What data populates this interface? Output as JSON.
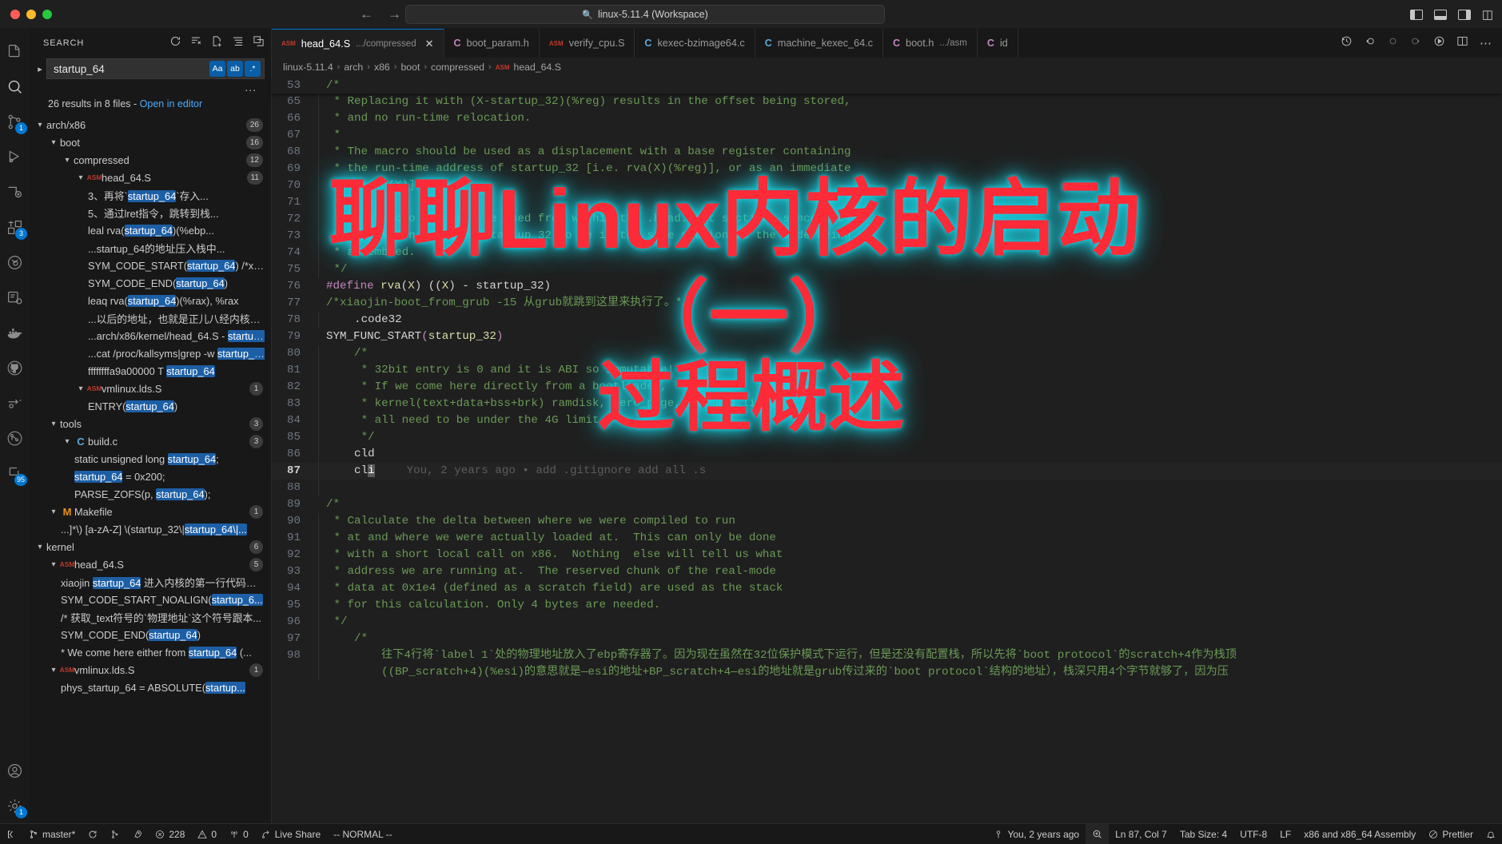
{
  "titlebar": {
    "quick_open": "linux-5.11.4 (Workspace)",
    "back_icon": "arrow-left-icon",
    "forward_icon": "arrow-right-icon",
    "search_icon": "search-icon",
    "layout_left": "toggle-primary-sidebar-icon",
    "layout_bottom": "toggle-panel-icon",
    "layout_right": "toggle-secondary-sidebar-icon",
    "customize_layout": "customize-layout-icon"
  },
  "activitybar": {
    "items": [
      {
        "name": "explorer",
        "badge": ""
      },
      {
        "name": "search",
        "badge": ""
      },
      {
        "name": "source-control",
        "badge": "1"
      },
      {
        "name": "run-and-debug",
        "badge": ""
      },
      {
        "name": "remote-explorer",
        "badge": ""
      },
      {
        "name": "extensions",
        "badge": "3"
      },
      {
        "name": "test-explorer",
        "badge": ""
      },
      {
        "name": "cpp-tools",
        "badge": ""
      },
      {
        "name": "docker",
        "badge": ""
      },
      {
        "name": "github",
        "badge": ""
      },
      {
        "name": "call-graph",
        "badge": ""
      },
      {
        "name": "git-graph",
        "badge": ""
      },
      {
        "name": "todo-tree",
        "badge": "95"
      },
      {
        "name": "accounts",
        "badge": ""
      },
      {
        "name": "settings",
        "badge": "1"
      }
    ]
  },
  "sidebar": {
    "title": "SEARCH",
    "actions": [
      "refresh-icon",
      "clear-search-results-icon",
      "open-new-search-editor-icon",
      "view-as-tree-icon",
      "collapse-all-icon"
    ],
    "search": {
      "value": "startup_64",
      "placeholder": "Search",
      "toggle_expand_icon": "chevron-right-icon",
      "options": [
        {
          "name": "match-case-toggle",
          "label": "Aa",
          "active": true
        },
        {
          "name": "match-whole-word-toggle",
          "label": "ab",
          "active": true
        },
        {
          "name": "use-regex-toggle",
          "label": ".*",
          "active": true
        }
      ],
      "more_icon": "..."
    },
    "summary": {
      "text": "26 results in 8 files - ",
      "link": "Open in editor"
    },
    "tree": [
      {
        "type": "folder",
        "indent": 0,
        "label": "arch/x86",
        "count": "26"
      },
      {
        "type": "folder",
        "indent": 1,
        "label": "boot",
        "count": "16"
      },
      {
        "type": "folder",
        "indent": 2,
        "label": "compressed",
        "count": "12"
      },
      {
        "type": "file",
        "indent": 3,
        "icon": "asm",
        "label": "head_64.S",
        "count": "11"
      },
      {
        "type": "match",
        "indent": 4,
        "pre": "3、再将`",
        "hit": "startup_64",
        "post": "`存入..."
      },
      {
        "type": "match",
        "indent": 4,
        "pre": "5、通过lret指令，跳转到栈...",
        "hit": "",
        "post": ""
      },
      {
        "type": "match",
        "indent": 4,
        "pre": "leal  rva(",
        "hit": "startup_64",
        "post": ")(%ebp..."
      },
      {
        "type": "match",
        "indent": 4,
        "pre": "...startup_64的地址压入栈中...",
        "hit": "",
        "post": ""
      },
      {
        "type": "match",
        "indent": 4,
        "pre": "SYM_CODE_START(",
        "hit": "startup_64",
        "post": ") /*xiaoj..."
      },
      {
        "type": "match",
        "indent": 4,
        "pre": "SYM_CODE_END(",
        "hit": "startup_64",
        "post": ")"
      },
      {
        "type": "match",
        "indent": 4,
        "pre": "leaq rva(",
        "hit": "startup_64",
        "post": ")(%rax), %rax"
      },
      {
        "type": "match",
        "indent": 4,
        "pre": "...以后的地址，也就是正儿八经内核代码段...",
        "hit": "",
        "post": ""
      },
      {
        "type": "match",
        "indent": 4,
        "pre": "...arch/x86/kernel/head_64.S - ",
        "hit": "startup_...",
        "post": ""
      },
      {
        "type": "match",
        "indent": 4,
        "pre": "...cat /proc/kallsyms|grep -w ",
        "hit": "startup_64",
        "post": ""
      },
      {
        "type": "match",
        "indent": 4,
        "pre": "ffffffffa9a00000 T ",
        "hit": "startup_64",
        "post": ""
      },
      {
        "type": "file",
        "indent": 3,
        "icon": "asm",
        "label": "vmlinux.lds.S",
        "count": "1"
      },
      {
        "type": "match",
        "indent": 4,
        "pre": "ENTRY(",
        "hit": "startup_64",
        "post": ")"
      },
      {
        "type": "folder",
        "indent": 1,
        "label": "tools",
        "count": "3"
      },
      {
        "type": "file",
        "indent": 2,
        "icon": "c",
        "label": "build.c",
        "count": "3"
      },
      {
        "type": "match",
        "indent": 3,
        "pre": "static unsigned long ",
        "hit": "startup_64",
        "post": ";"
      },
      {
        "type": "match",
        "indent": 3,
        "pre": "",
        "hit": "startup_64",
        "post": " = 0x200;"
      },
      {
        "type": "match",
        "indent": 3,
        "pre": "PARSE_ZOFS(p, ",
        "hit": "startup_64",
        "post": ");"
      },
      {
        "type": "file",
        "indent": 1,
        "icon": "mk",
        "label": "Makefile",
        "count": "1"
      },
      {
        "type": "match",
        "indent": 2,
        "pre": "...]*\\) [a-zA-Z] \\(startup_32\\|",
        "hit": "startup_64\\|...",
        "post": ""
      },
      {
        "type": "folder",
        "indent": 0,
        "label": "kernel",
        "count": "6"
      },
      {
        "type": "file",
        "indent": 1,
        "icon": "asm",
        "label": "head_64.S",
        "count": "5"
      },
      {
        "type": "match",
        "indent": 2,
        "pre": "xiaojin ",
        "hit": "startup_64",
        "post": " 进入内核的第一行代码运..."
      },
      {
        "type": "match",
        "indent": 2,
        "pre": "SYM_CODE_START_NOALIGN(",
        "hit": "startup_6...",
        "post": ""
      },
      {
        "type": "match",
        "indent": 2,
        "pre": "/* 获取_text符号的`物理地址`这个符号跟本...",
        "hit": "",
        "post": ""
      },
      {
        "type": "match",
        "indent": 2,
        "pre": "SYM_CODE_END(",
        "hit": "startup_64",
        "post": ")"
      },
      {
        "type": "match",
        "indent": 2,
        "pre": "* We come here either from ",
        "hit": "startup_64",
        "post": " (..."
      },
      {
        "type": "file",
        "indent": 1,
        "icon": "asm",
        "label": "vmlinux.lds.S",
        "count": "1"
      },
      {
        "type": "match",
        "indent": 2,
        "pre": "phys_startup_64 = ABSOLUTE(",
        "hit": "startup...",
        "post": ""
      }
    ]
  },
  "tabs": [
    {
      "name": "head_64.S",
      "icon": "asm",
      "sub": ".../compressed",
      "active": true,
      "closable": true
    },
    {
      "name": "boot_param.h",
      "icon": "c-purple",
      "sub": "",
      "active": false
    },
    {
      "name": "verify_cpu.S",
      "icon": "asm",
      "sub": "",
      "active": false
    },
    {
      "name": "kexec-bzimage64.c",
      "icon": "c-blue",
      "sub": "",
      "active": false
    },
    {
      "name": "machine_kexec_64.c",
      "icon": "c-blue",
      "sub": "",
      "active": false
    },
    {
      "name": "boot.h",
      "icon": "c-purple",
      "sub": ".../asm",
      "active": false
    },
    {
      "name": "id",
      "icon": "c-purple",
      "sub": "",
      "active": false
    }
  ],
  "tabbar_right_icons": [
    "history-icon",
    "go-back-icon",
    "go-to-icon",
    "go-forward-icon",
    "run-icon",
    "split-editor-icon",
    "more-actions-icon"
  ],
  "breadcrumb": [
    "linux-5.11.4",
    "arch",
    "x86",
    "boot",
    "compressed",
    "head_64.S"
  ],
  "editor": {
    "sticky_line": {
      "num": "53",
      "text": "/*"
    },
    "lines": [
      {
        "num": "65",
        "indent": 1,
        "text": " * Replacing it with (X-startup_32)(%reg) results in the offset being stored,",
        "cls": "cmt"
      },
      {
        "num": "66",
        "indent": 1,
        "text": " * and no run-time relocation.",
        "cls": "cmt"
      },
      {
        "num": "67",
        "indent": 1,
        "text": " *",
        "cls": "cmt"
      },
      {
        "num": "68",
        "indent": 1,
        "text": " * The macro should be used as a displacement with a base register containing",
        "cls": "cmt"
      },
      {
        "num": "69",
        "indent": 1,
        "text": " * the run-time address of startup_32 [i.e. rva(X)(%reg)], or as an immediate",
        "cls": "cmt"
      },
      {
        "num": "70",
        "indent": 1,
        "text": " * [$ rva(X)].",
        "cls": "cmt"
      },
      {
        "num": "71",
        "indent": 1,
        "text": " *",
        "cls": "cmt"
      },
      {
        "num": "72",
        "indent": 1,
        "text": " * This macro can only be used from within the .head.text section, since the",
        "cls": "cmt"
      },
      {
        "num": "73",
        "indent": 1,
        "text": " * expression requires startup_32 to be in the same section as the code being",
        "cls": "cmt"
      },
      {
        "num": "74",
        "indent": 1,
        "text": " * assembled.",
        "cls": "cmt"
      },
      {
        "num": "75",
        "indent": 1,
        "text": " */",
        "cls": "cmt"
      },
      {
        "num": "76",
        "indent": 0,
        "text": "#define rva(X) ((X) - startup_32)",
        "cls": "define"
      },
      {
        "num": "77",
        "indent": 0,
        "text": "/*xiaojin-boot_from_grub -15 从grub就跳到这里来执行了。*/",
        "cls": "cmt"
      },
      {
        "num": "78",
        "indent": 1,
        "text": "    .code32",
        "cls": "id"
      },
      {
        "num": "79",
        "indent": 0,
        "text": "SYM_FUNC_START(startup_32)",
        "cls": "func"
      },
      {
        "num": "80",
        "indent": 1,
        "text": "    /*",
        "cls": "cmt"
      },
      {
        "num": "81",
        "indent": 1,
        "text": "     * 32bit entry is 0 and it is ABI so immutable!",
        "cls": "cmt"
      },
      {
        "num": "82",
        "indent": 1,
        "text": "     * If we come here directly from a bootloader,",
        "cls": "cmt"
      },
      {
        "num": "83",
        "indent": 1,
        "text": "     * kernel(text+data+bss+brk) ramdisk, zero_page, command line",
        "cls": "cmt"
      },
      {
        "num": "84",
        "indent": 1,
        "text": "     * all need to be under the 4G limit.",
        "cls": "cmt"
      },
      {
        "num": "85",
        "indent": 1,
        "text": "     */",
        "cls": "cmt"
      },
      {
        "num": "86",
        "indent": 1,
        "text": "    cld",
        "cls": "id"
      },
      {
        "num": "87",
        "indent": 1,
        "text": "    cli",
        "cls": "id",
        "current": true,
        "blame": "You, 2 years ago • add .gitignore add all .s"
      },
      {
        "num": "88",
        "indent": 1,
        "text": "",
        "cls": "id"
      },
      {
        "num": "89",
        "indent": 0,
        "text": "/*",
        "cls": "cmt"
      },
      {
        "num": "90",
        "indent": 1,
        "text": " * Calculate the delta between where we were compiled to run",
        "cls": "cmt"
      },
      {
        "num": "91",
        "indent": 1,
        "text": " * at and where we were actually loaded at.  This can only be done",
        "cls": "cmt"
      },
      {
        "num": "92",
        "indent": 1,
        "text": " * with a short local call on x86.  Nothing  else will tell us what",
        "cls": "cmt"
      },
      {
        "num": "93",
        "indent": 1,
        "text": " * address we are running at.  The reserved chunk of the real-mode",
        "cls": "cmt"
      },
      {
        "num": "94",
        "indent": 1,
        "text": " * data at 0x1e4 (defined as a scratch field) are used as the stack",
        "cls": "cmt"
      },
      {
        "num": "95",
        "indent": 1,
        "text": " * for this calculation. Only 4 bytes are needed.",
        "cls": "cmt"
      },
      {
        "num": "96",
        "indent": 1,
        "text": " */",
        "cls": "cmt"
      },
      {
        "num": "97",
        "indent": 1,
        "text": "    /*",
        "cls": "cmt"
      },
      {
        "num": "98",
        "indent": 1,
        "text": "        往下4行将`label 1`处的物理地址放入了ebp寄存器了。因为现在虽然在32位保护模式下运行，但是还没有配置栈，所以先将`boot protocol`的scratch+4作为栈顶",
        "cls": "cmt"
      },
      {
        "num": "",
        "indent": 1,
        "text": "        ((BP_scratch+4)(%esi)的意思就是—esi的地址+BP_scratch+4—esi的地址就是grub传过来的`boot protocol`结构的地址），栈深只用4个字节就够了，因为压",
        "cls": "cmt"
      }
    ]
  },
  "statusbar": {
    "left": [
      {
        "name": "remote-indicator",
        "icon": "remote-icon",
        "text": ""
      },
      {
        "name": "git-branch",
        "icon": "git-branch-icon",
        "text": "master*"
      },
      {
        "name": "sync-changes",
        "icon": "sync-icon",
        "text": ""
      },
      {
        "name": "git-graph",
        "icon": "git-graph-icon",
        "text": ""
      },
      {
        "name": "rocket",
        "icon": "rocket-icon",
        "text": ""
      },
      {
        "name": "problems-errors",
        "icon": "error-icon",
        "text": "228"
      },
      {
        "name": "problems-warnings",
        "icon": "warning-icon",
        "text": "0"
      },
      {
        "name": "ports",
        "icon": "radio-tower-icon",
        "text": "0"
      },
      {
        "name": "live-share",
        "icon": "live-share-icon",
        "text": "Live Share"
      },
      {
        "name": "vim-mode",
        "icon": "",
        "text": "-- NORMAL --"
      }
    ],
    "right": [
      {
        "name": "git-blame",
        "icon": "person-icon",
        "text": "You, 2 years ago"
      },
      {
        "name": "search-status",
        "icon": "zoom-icon",
        "text": "",
        "highlight": true
      },
      {
        "name": "editor-position",
        "icon": "",
        "text": "Ln 87, Col 7"
      },
      {
        "name": "indentation",
        "icon": "",
        "text": "Tab Size: 4"
      },
      {
        "name": "encoding",
        "icon": "",
        "text": "UTF-8"
      },
      {
        "name": "eol",
        "icon": "",
        "text": "LF"
      },
      {
        "name": "language-mode",
        "icon": "",
        "text": "x86 and x86_64 Assembly"
      },
      {
        "name": "prettier",
        "icon": "prettier-icon",
        "text": "Prettier"
      },
      {
        "name": "notifications",
        "icon": "bell-icon",
        "text": ""
      }
    ]
  },
  "watermark": {
    "line1": "聊聊Linux内核的启动",
    "line2": "（一）",
    "line3": "过程概述",
    "color": "#fd2a38",
    "glow": "#19d7e8"
  }
}
